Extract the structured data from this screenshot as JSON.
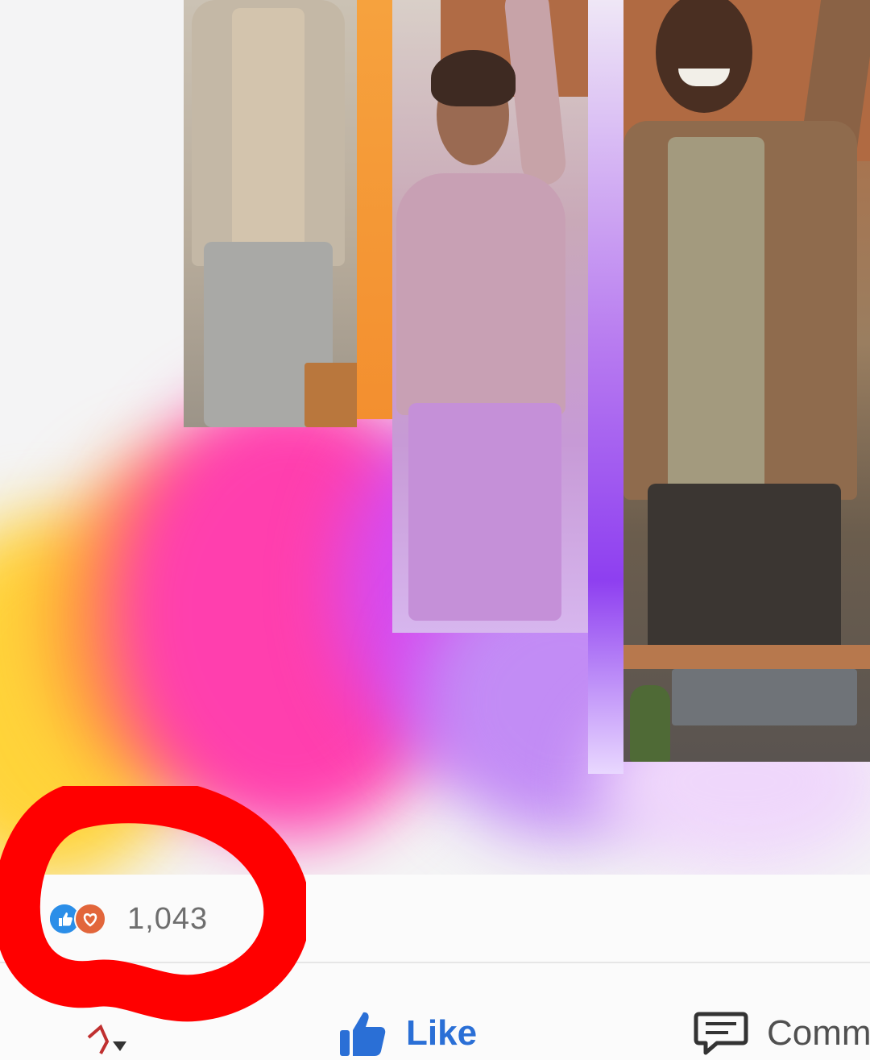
{
  "post": {
    "reactions": {
      "count": "1,043",
      "types": [
        "like",
        "love"
      ]
    },
    "actions": {
      "like_label": "Like",
      "comment_label": "Comm"
    }
  },
  "icons": {
    "like_reaction": "thumbs-up-icon",
    "love_reaction": "heart-icon",
    "like_action": "thumbs-up-icon",
    "comment_action": "speech-bubble-icon"
  },
  "colors": {
    "like_blue": "#2a6fd6",
    "love_orange": "#e2663b",
    "annotation_red": "#ff0000"
  }
}
